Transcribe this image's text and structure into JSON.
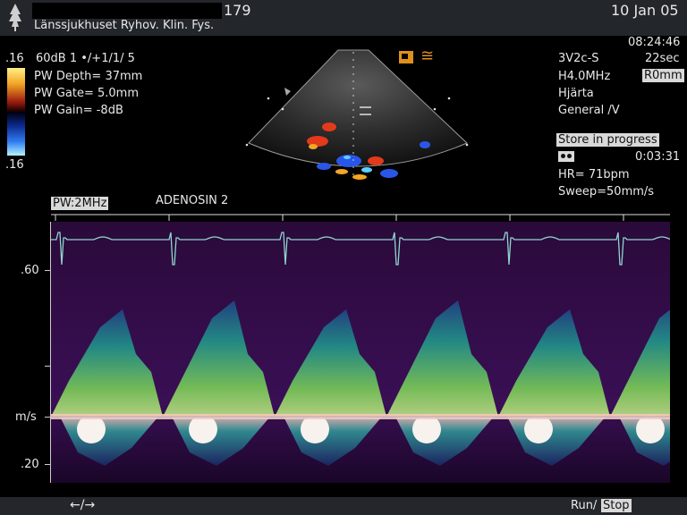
{
  "header": {
    "logo_icon": "tree-logo-icon",
    "patient_id_number": "179",
    "hospital": "Länssjukhuset Ryhov.  Klin. Fys.",
    "date": "10 Jan 05"
  },
  "left_params": {
    "scale_top": ".16",
    "scale_bottom": ".16",
    "gain_line": "60dB   1 •/+1/1/ 5",
    "pw_depth": "PW Depth=  37mm",
    "pw_gate": "PW Gate=  5.0mm",
    "pw_gain": "PW Gain=  -8dB"
  },
  "right_params": {
    "time": "08:24:46",
    "probe": "3V2c-S",
    "duration": "22sec",
    "freq": "H4.0MHz",
    "r0mm": "R0mm",
    "organ": "Hjärta",
    "preset": "General /V",
    "store_status": "Store in progress",
    "elapsed": "0:03:31",
    "hr": "HR=  71bpm",
    "sweep": "Sweep=50mm/s"
  },
  "doppler": {
    "pw_label": "PW:2MHz",
    "annotation": "ADENOSIN 2",
    "axis_top": ".60",
    "axis_unit": "m/s",
    "axis_bottom": ".20"
  },
  "footer": {
    "nav_arrows": "←/→",
    "run": "Run/",
    "stop": "Stop"
  }
}
